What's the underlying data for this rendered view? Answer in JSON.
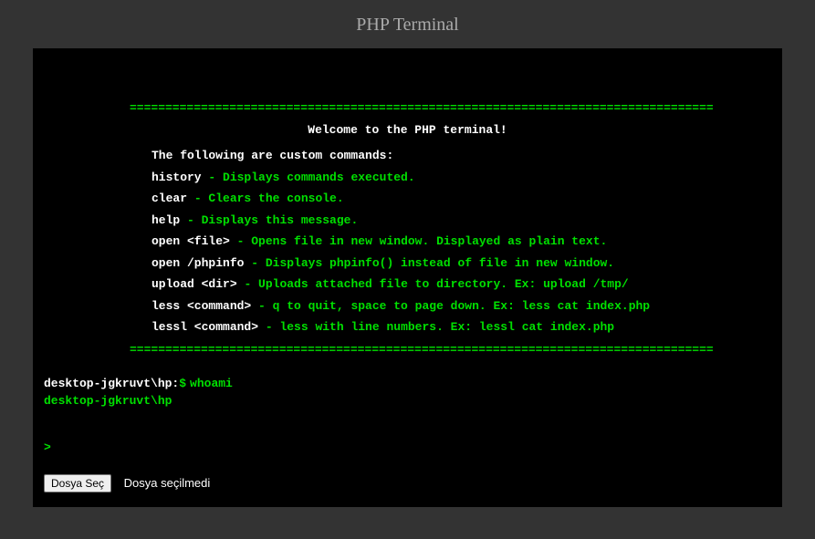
{
  "title": "PHP Terminal",
  "banner": {
    "divider": "==================================================================================",
    "welcome": "Welcome to the PHP terminal!",
    "intro": "The following are custom commands:",
    "commands": [
      {
        "cmd": "history",
        "desc": "- Displays commands executed."
      },
      {
        "cmd": "clear",
        "desc": "- Clears the console."
      },
      {
        "cmd": "help",
        "desc": "- Displays this message."
      },
      {
        "cmd": "open <file>",
        "desc": "- Opens file in new window. Displayed as plain text."
      },
      {
        "cmd": "open /phpinfo",
        "desc": "- Displays phpinfo() instead of file in new window."
      },
      {
        "cmd": "upload <dir>",
        "desc": "- Uploads attached file to directory. Ex: upload /tmp/"
      },
      {
        "cmd": "less <command>",
        "desc": "- q to quit, space to page down. Ex: less cat index.php"
      },
      {
        "cmd": "lessl <command>",
        "desc": "- less with line numbers. Ex: lessl cat index.php"
      }
    ]
  },
  "history": {
    "prompt_host": "desktop-jgkruvt\\hp:",
    "prompt_symbol": "$",
    "command": "whoami",
    "output": "desktop-jgkruvt\\hp"
  },
  "current": {
    "prompt": ">"
  },
  "fileInput": {
    "button": "Dosya Seç",
    "status": "Dosya seçilmedi"
  }
}
